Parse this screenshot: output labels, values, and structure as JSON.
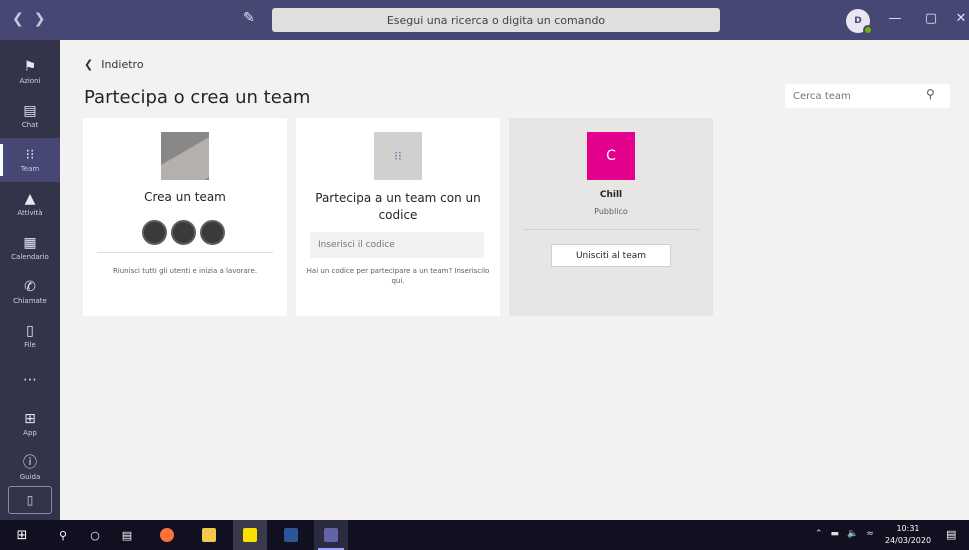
{
  "titlebar": {
    "search_placeholder": "Esegui una ricerca o digita un comando",
    "avatar_initials": "D"
  },
  "rail": {
    "items": [
      {
        "label": "Azioni",
        "icon": "bell-icon"
      },
      {
        "label": "Chat",
        "icon": "chat-icon"
      },
      {
        "label": "Team",
        "icon": "team-icon",
        "active": true
      },
      {
        "label": "Attività",
        "icon": "bag-icon"
      },
      {
        "label": "Calendario",
        "icon": "calendar-icon"
      },
      {
        "label": "Chiamate",
        "icon": "phone-icon"
      },
      {
        "label": "File",
        "icon": "file-icon"
      },
      {
        "label": "",
        "icon": "more-icon"
      },
      {
        "label": "App",
        "icon": "apps-icon"
      },
      {
        "label": "Guida",
        "icon": "help-icon"
      }
    ]
  },
  "main": {
    "back_label": "Indietro",
    "title": "Partecipa o crea un team",
    "search_placeholder": "Cerca team"
  },
  "cards": {
    "create": {
      "title": "Crea un team",
      "description": "Riunisci tutti gli utenti e inizia a lavorare."
    },
    "join_code": {
      "title": "Partecipa a un team con un codice",
      "input_placeholder": "Inserisci il codice",
      "description": "Hai un codice per partecipare a un team? Inseriscilo qui."
    },
    "suggested": {
      "initial": "C",
      "name": "Chill",
      "visibility": "Pubblico",
      "button_label": "Unisciti al team",
      "color": "#e3008c"
    }
  },
  "taskbar": {
    "time": "10:31",
    "date": "24/03/2020"
  },
  "colors": {
    "titlebar": "#464775",
    "rail": "#33344a",
    "accent": "#6264a7"
  }
}
